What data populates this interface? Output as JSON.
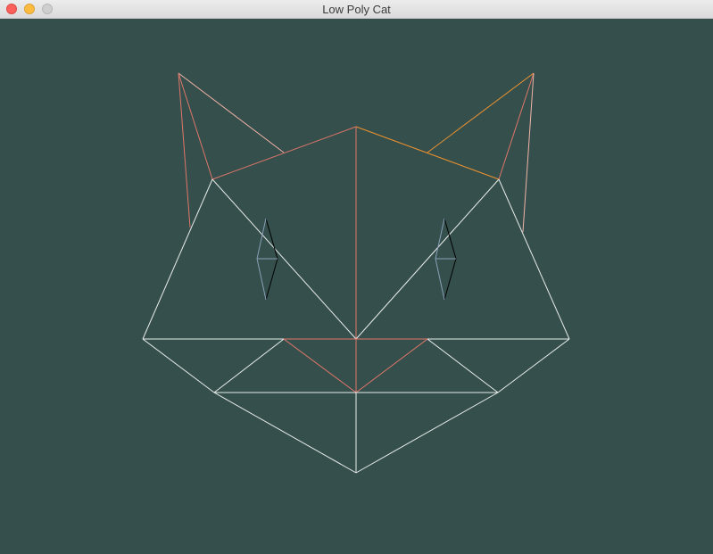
{
  "window": {
    "title": "Low Poly Cat"
  },
  "colors": {
    "background": "#344f4c",
    "white": "#e8ecea",
    "salmon": "#e0776a",
    "orange": "#f0922e",
    "pink": "#f3b3a6",
    "eye": "#000000",
    "eye_highlight": "#8aa0b8"
  }
}
